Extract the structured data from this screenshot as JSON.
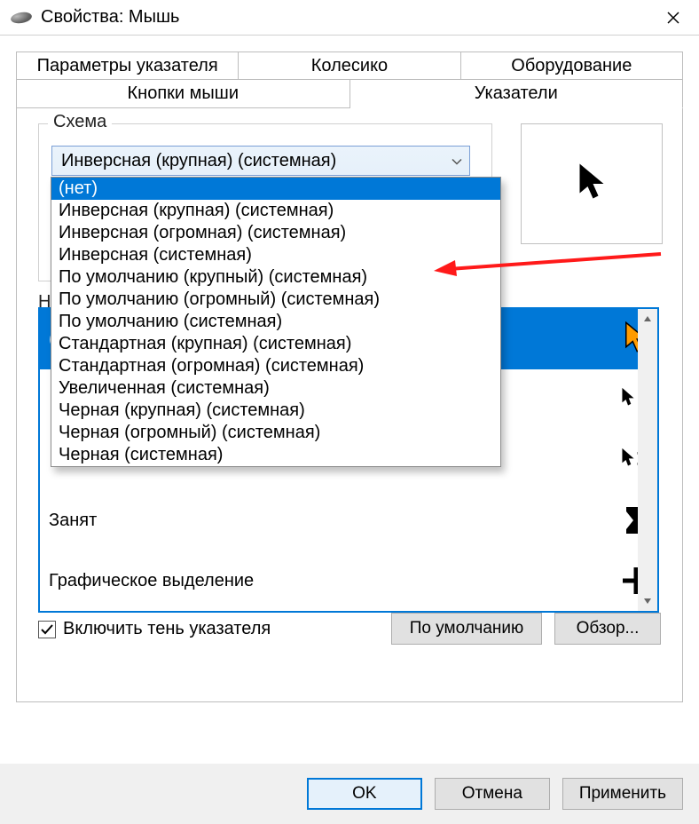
{
  "window": {
    "title": "Свойства: Мышь"
  },
  "tabs": {
    "row1": [
      "Параметры указателя",
      "Колесико",
      "Оборудование"
    ],
    "row2": [
      "Кнопки мыши",
      "Указатели"
    ],
    "active": "Указатели"
  },
  "scheme": {
    "legend": "Схема",
    "selected": "Инверсная (крупная) (системная)",
    "options": [
      "(нет)",
      "Инверсная (крупная) (системная)",
      "Инверсная (огромная) (системная)",
      "Инверсная (системная)",
      "По умолчанию (крупный) (системная)",
      "По умолчанию (огромный) (системная)",
      "По умолчанию (системная)",
      "Стандартная (крупная) (системная)",
      "Стандартная (огромная) (системная)",
      "Увеличенная (системная)",
      "Черная (крупная) (системная)",
      "Черная (огромный) (системная)",
      "Черная (системная)"
    ],
    "highlighted_index": 0
  },
  "list": {
    "partially_hidden_prefix": "Н",
    "rows": [
      {
        "label_fragment": "(",
        "icon": "arrow-orange",
        "selected": true
      },
      {
        "label_fragment": "",
        "icon": "help-select"
      },
      {
        "label_fragment": "",
        "icon": "arrow-hourglass"
      },
      {
        "label": "Занят",
        "icon": "hourglass"
      },
      {
        "label": "Графическое выделение",
        "icon": "precision"
      }
    ]
  },
  "checkbox": {
    "label": "Включить тень указателя",
    "checked": true
  },
  "buttons": {
    "defaults": "По умолчанию",
    "browse": "Обзор...",
    "ok": "OK",
    "cancel": "Отмена",
    "apply": "Применить"
  },
  "icons": {
    "close": "close-icon",
    "chevron": "chevron-down-icon",
    "cursor_black": "cursor-icon",
    "cursor_orange": "cursor-orange-icon",
    "help_select": "help-select-icon",
    "working": "working-icon",
    "busy": "busy-icon",
    "precision": "precision-icon",
    "check": "check-icon",
    "scroll_up": "scroll-up-icon",
    "scroll_down": "scroll-down-icon",
    "app": "mouse-app-icon",
    "arrow_annotation": "red-arrow-annotation"
  }
}
